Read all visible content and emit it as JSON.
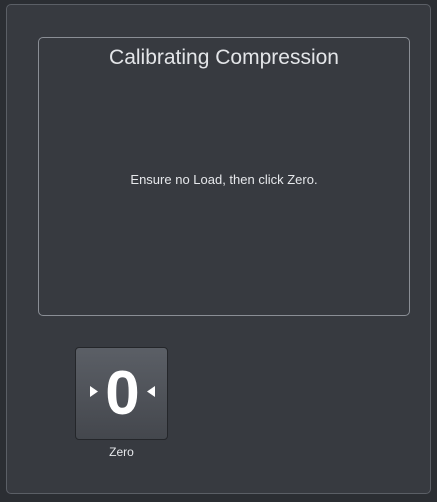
{
  "dialog": {
    "title": "Calibrating Compression",
    "message": "Ensure no Load, then click Zero."
  },
  "actions": {
    "zero_icon_glyph": "0",
    "zero_label": "Zero"
  },
  "icons": {
    "zero_button_icon": "zero-with-inward-arrows-icon"
  },
  "colors": {
    "background": "#2b2e33",
    "panel": "#373a40",
    "text": "#e6e8eb",
    "button": "#52565d"
  }
}
